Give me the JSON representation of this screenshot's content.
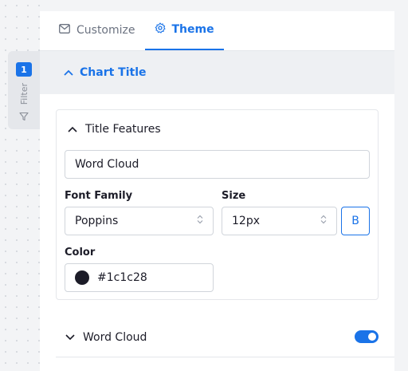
{
  "filter": {
    "badge": "1",
    "label": "Filter"
  },
  "tabs": [
    {
      "label": "Customize",
      "icon": "envelope-icon",
      "active": false
    },
    {
      "label": "Theme",
      "icon": "gear-icon",
      "active": true
    }
  ],
  "section": {
    "title": "Chart Title"
  },
  "title_features": {
    "header": "Title Features",
    "title_value": "Word Cloud",
    "font_family_label": "Font Family",
    "font_family_value": "Poppins",
    "size_label": "Size",
    "size_value": "12px",
    "bold_label": "B",
    "color_label": "Color",
    "color_value": "#1c1c28"
  },
  "word_cloud": {
    "label": "Word Cloud",
    "enabled": true
  },
  "colors": {
    "accent": "#1a73e8",
    "text": "#1c1c28",
    "muted": "#6b7280"
  }
}
